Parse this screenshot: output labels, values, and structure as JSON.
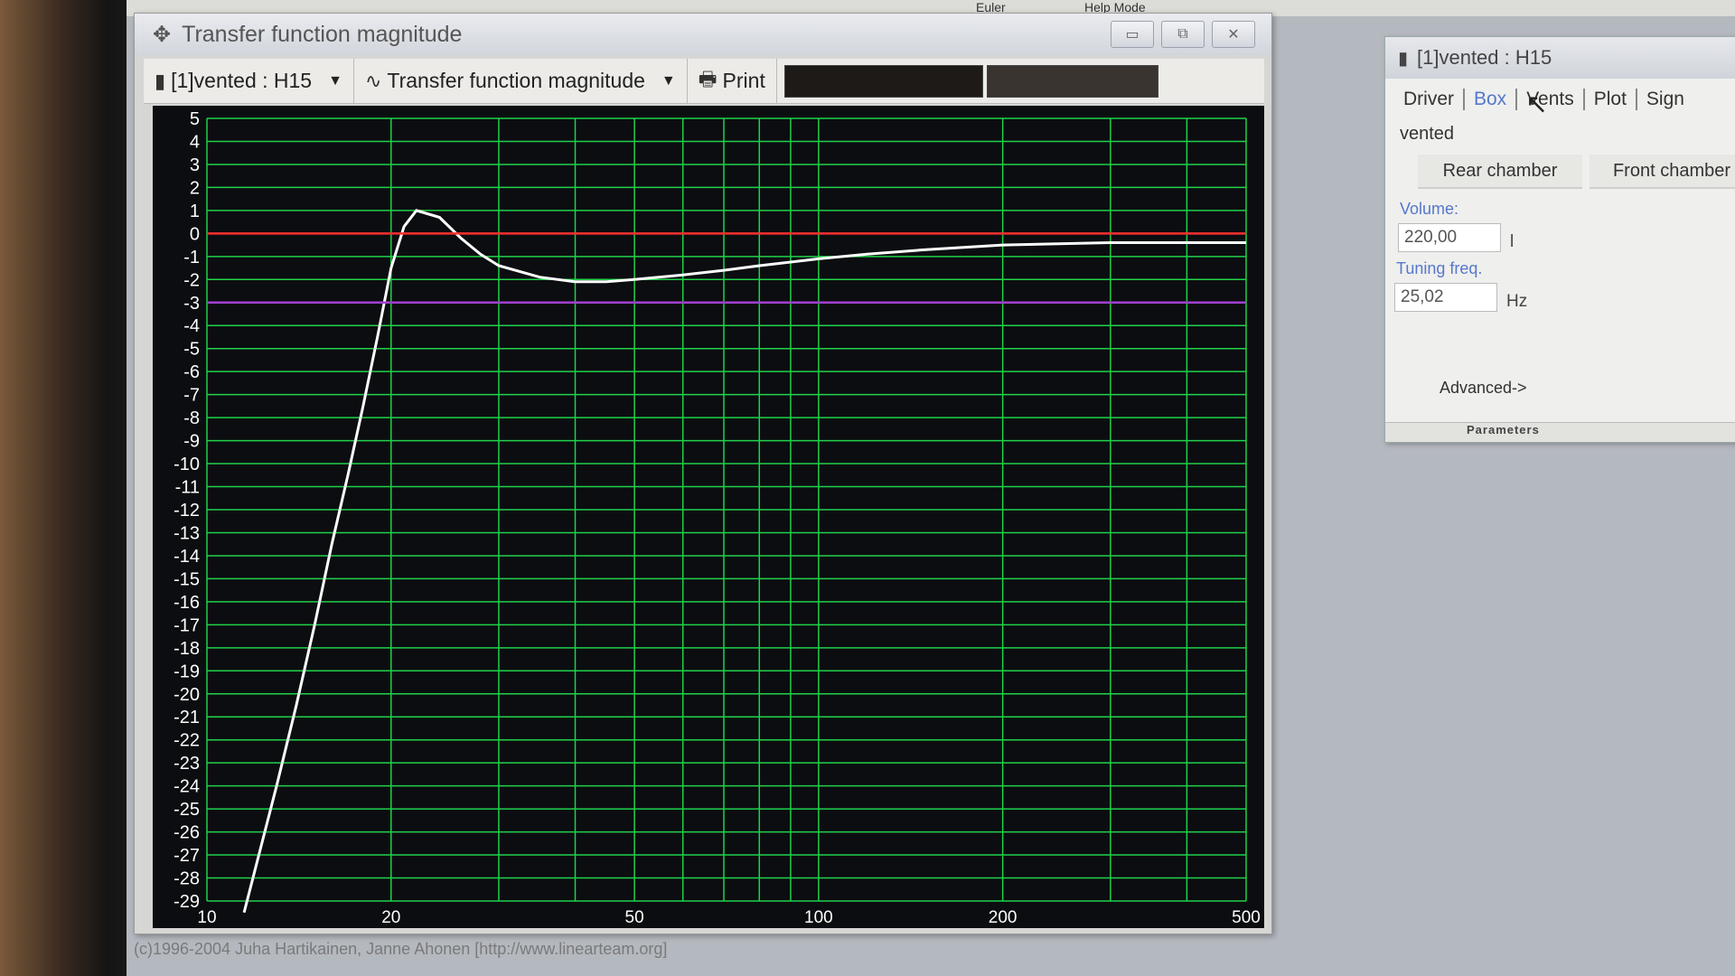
{
  "top_strip": {
    "item1": "Euler",
    "item2": "Help Mode"
  },
  "chart_window": {
    "title": "Transfer function magnitude",
    "title_icon": "crosshair-icon",
    "toolbar": {
      "project_label": "[1]vented : H15",
      "view_label": "Transfer function magnitude",
      "print_label": "Print"
    }
  },
  "chart_data": {
    "type": "line",
    "title": "",
    "xlabel": "",
    "ylabel": "",
    "x_scale": "log",
    "xlim": [
      10,
      500
    ],
    "ylim": [
      -29,
      5
    ],
    "x_tick_labels": [
      "10",
      "20",
      "50",
      "100",
      "200",
      "500"
    ],
    "x_tick_values": [
      10,
      20,
      50,
      100,
      200,
      500
    ],
    "y_tick_labels": [
      "5",
      "4",
      "3",
      "2",
      "1",
      "0",
      "-1",
      "-2",
      "-3",
      "-4",
      "-5",
      "-6",
      "-7",
      "-8",
      "-9",
      "-10",
      "-11",
      "-12",
      "-13",
      "-14",
      "-15",
      "-16",
      "-17",
      "-18",
      "-19",
      "-20",
      "-21",
      "-22",
      "-23",
      "-24",
      "-25",
      "-26",
      "-27",
      "-28",
      "-29"
    ],
    "grid": true,
    "grid_color": "#1fd24a",
    "background": "#0c0d10",
    "series": [
      {
        "color": "#ffffff",
        "x": [
          11.5,
          13,
          14,
          15,
          16,
          17,
          18,
          19,
          20,
          21,
          22,
          24,
          26,
          28,
          30,
          35,
          40,
          45,
          50,
          60,
          70,
          80,
          100,
          120,
          150,
          200,
          300,
          400,
          500
        ],
        "y": [
          -29.5,
          -24,
          -20.5,
          -17,
          -13.5,
          -10.5,
          -7.5,
          -4.5,
          -1.5,
          0.3,
          1.0,
          0.7,
          -0.2,
          -0.9,
          -1.4,
          -1.9,
          -2.1,
          -2.1,
          -2.0,
          -1.8,
          -1.6,
          -1.4,
          -1.1,
          -0.9,
          -0.7,
          -0.5,
          -0.4,
          -0.4,
          -0.4
        ]
      },
      {
        "color": "#ff3030",
        "x": [
          10,
          500
        ],
        "y": [
          0,
          0
        ]
      },
      {
        "color": "#a040d0",
        "x": [
          10,
          500
        ],
        "y": [
          -3,
          -3
        ]
      }
    ]
  },
  "copyright": "(c)1996-2004 Juha Hartikainen, Janne Ahonen [http://www.linearteam.org]",
  "params": {
    "title": "[1]vented :  H15",
    "tabs": [
      "Driver",
      "Box",
      "Vents",
      "Plot",
      "Sign"
    ],
    "active_tab": "Box",
    "box_type": "vented",
    "rear_chamber": "Rear chamber",
    "front_chamber": "Front chamber",
    "volume_label": "Volume:",
    "volume_value": "220,00",
    "volume_unit": "l",
    "tuning_label": "Tuning freq.",
    "tuning_value": "25,02",
    "tuning_unit": "Hz",
    "advanced": "Advanced->",
    "footer": "Parameters"
  }
}
